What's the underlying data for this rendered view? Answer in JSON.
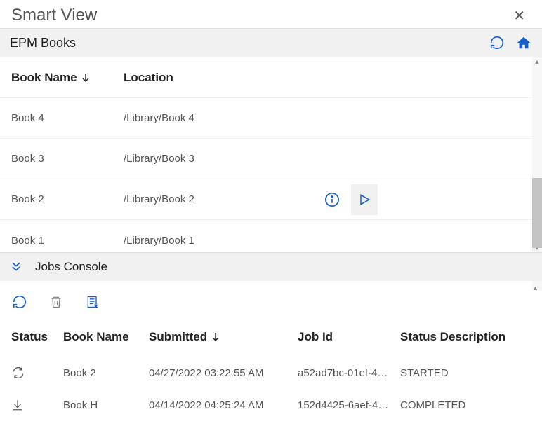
{
  "panel": {
    "title": "Smart View"
  },
  "subheader": {
    "title": "EPM Books"
  },
  "upper": {
    "columns": {
      "bookname": "Book Name",
      "location": "Location"
    },
    "rows": [
      {
        "name": "Book 4",
        "location": "/Library/Book 4"
      },
      {
        "name": "Book 3",
        "location": "/Library/Book 3"
      },
      {
        "name": "Book 2",
        "location": "/Library/Book 2"
      },
      {
        "name": "Book 1",
        "location": "/Library/Book 1"
      }
    ]
  },
  "jobs": {
    "title": "Jobs Console",
    "columns": {
      "status": "Status",
      "book": "Book Name",
      "submitted": "Submitted",
      "jobid": "Job Id",
      "desc": "Status Description"
    },
    "rows": [
      {
        "status_icon": "running",
        "book": "Book 2",
        "submitted": "04/27/2022 03:22:55 AM",
        "jobid": "a52ad7bc-01ef-4…",
        "desc": "STARTED"
      },
      {
        "status_icon": "download",
        "book": "Book H",
        "submitted": "04/14/2022 04:25:24 AM",
        "jobid": "152d4425-6aef-4…",
        "desc": "COMPLETED"
      }
    ]
  },
  "colors": {
    "accent": "#145ecc",
    "muted": "#888"
  }
}
